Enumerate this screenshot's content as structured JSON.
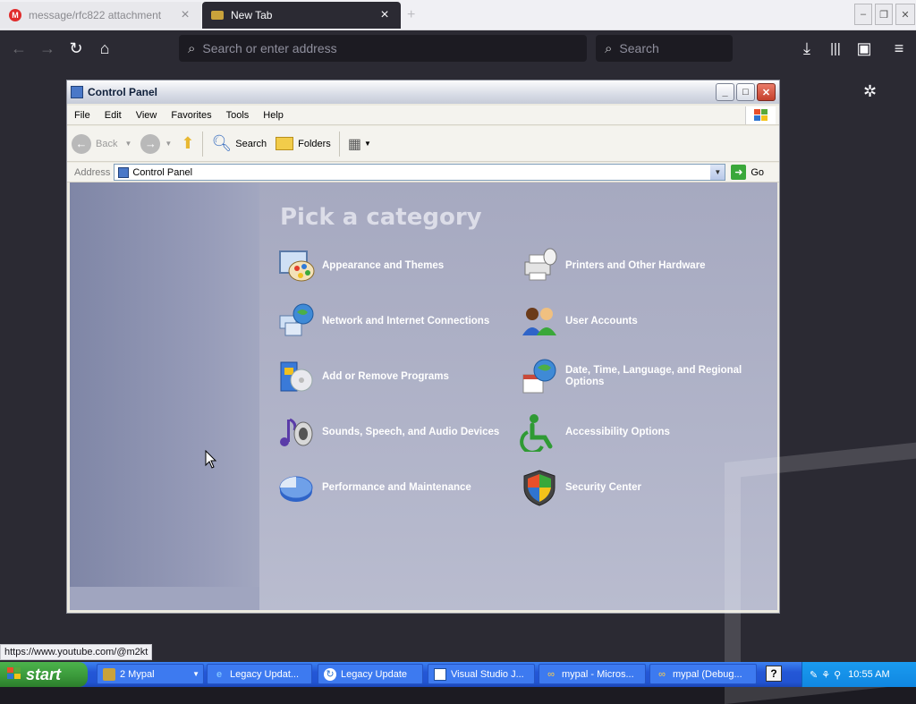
{
  "browser": {
    "tabs": [
      {
        "label": "message/rfc822 attachment",
        "active": false,
        "favicon": "m-logo"
      },
      {
        "label": "New Tab",
        "active": true,
        "favicon": "tab-icon"
      }
    ],
    "new_tab_symbol": "+",
    "address_placeholder": "Search or enter address",
    "search_placeholder": "Search",
    "status_link": "https://www.youtube.com/@m2kt"
  },
  "window": {
    "title": "Control Panel",
    "menu": [
      "File",
      "Edit",
      "View",
      "Favorites",
      "Tools",
      "Help"
    ],
    "toolbar": {
      "back": "Back",
      "search": "Search",
      "folders": "Folders"
    },
    "address_label": "Address",
    "address_value": "Control Panel",
    "go_label": "Go"
  },
  "heading": "Pick a category",
  "categories": [
    {
      "label": "Appearance and Themes",
      "icon": "appearance-icon"
    },
    {
      "label": "Printers and Other Hardware",
      "icon": "printer-icon"
    },
    {
      "label": "Network and Internet Connections",
      "icon": "network-icon"
    },
    {
      "label": "User Accounts",
      "icon": "users-icon"
    },
    {
      "label": "Add or Remove Programs",
      "icon": "programs-icon"
    },
    {
      "label": "Date, Time, Language, and Regional Options",
      "icon": "calendar-globe-icon"
    },
    {
      "label": "Sounds, Speech, and Audio Devices",
      "icon": "music-speaker-icon"
    },
    {
      "label": "Accessibility Options",
      "icon": "accessibility-icon"
    },
    {
      "label": "Performance and Maintenance",
      "icon": "pie-chart-icon"
    },
    {
      "label": "Security Center",
      "icon": "shield-icon"
    }
  ],
  "taskbar": {
    "start": "start",
    "tasks": [
      "2 Mypal",
      "Legacy Updat...",
      "Legacy Update",
      "Visual Studio J...",
      "mypal - Micros...",
      "mypal (Debug..."
    ],
    "clock": "10:55 AM"
  },
  "colors": {
    "xp_blue": "#2457d6",
    "start_green": "#3b9a3b",
    "category_bg": "#b1b4c9"
  }
}
